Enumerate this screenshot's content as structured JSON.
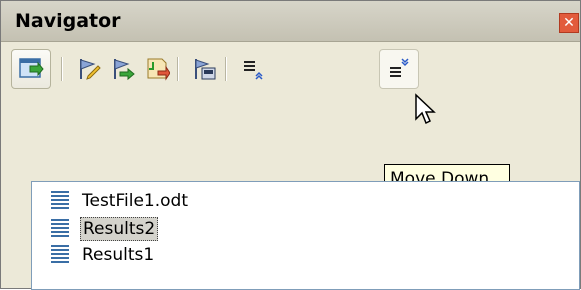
{
  "window": {
    "title": "Navigator",
    "close_label": "✕"
  },
  "toolbar": {
    "buttons": [
      {
        "icon": "navigator-toggle-icon",
        "state": "pressed"
      },
      {
        "icon": "edit-flag-icon"
      },
      {
        "icon": "next-flag-icon"
      },
      {
        "icon": "drag-mode-icon"
      },
      {
        "icon": "content-view-icon"
      },
      {
        "icon": "move-up-icon"
      },
      {
        "icon": "move-down-icon",
        "state": "hover"
      }
    ]
  },
  "tooltip": {
    "text": "Move Down"
  },
  "tree": {
    "items": [
      {
        "label": "TestFile1.odt",
        "selected": false
      },
      {
        "label": "Results2",
        "selected": true
      },
      {
        "label": "Results1",
        "selected": false
      }
    ]
  },
  "colors": {
    "window_bg": "#ece9d8",
    "tooltip_bg": "#ffffe1",
    "selection_bg": "#d4d3cc",
    "close_btn": "#e25b3c"
  }
}
